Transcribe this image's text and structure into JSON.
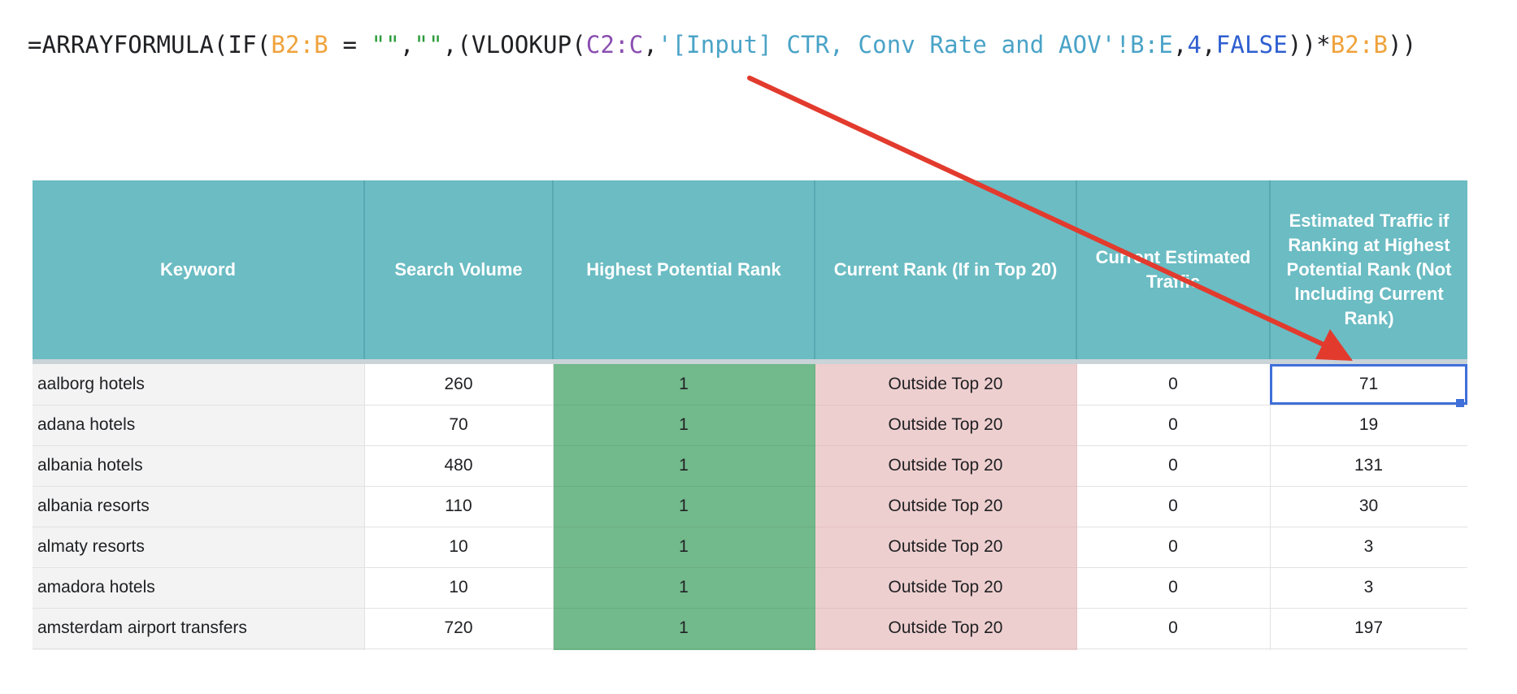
{
  "formula": {
    "tokens": [
      {
        "text": "=ARRAYFORMULA(IF(",
        "color": "#202124"
      },
      {
        "text": "B2:B",
        "color": "#f0a23b"
      },
      {
        "text": " = ",
        "color": "#202124"
      },
      {
        "text": "\"\"",
        "color": "#2b9c3a"
      },
      {
        "text": ",",
        "color": "#202124"
      },
      {
        "text": "\"\"",
        "color": "#2b9c3a"
      },
      {
        "text": ",(VLOOKUP(",
        "color": "#202124"
      },
      {
        "text": "C2:C",
        "color": "#8a4fb0"
      },
      {
        "text": ",",
        "color": "#202124"
      },
      {
        "text": "'[Input] CTR, Conv Rate and AOV'!B:E",
        "color": "#4aa3c7"
      },
      {
        "text": ",",
        "color": "#202124"
      },
      {
        "text": "4",
        "color": "#2f5fd0"
      },
      {
        "text": ",",
        "color": "#202124"
      },
      {
        "text": "FALSE",
        "color": "#2f5fd0"
      },
      {
        "text": "))*",
        "color": "#202124"
      },
      {
        "text": "B2:B",
        "color": "#f0a23b"
      },
      {
        "text": "))",
        "color": "#202124"
      }
    ]
  },
  "table": {
    "headers": [
      "Keyword",
      "Search Volume",
      "Highest Potential Rank",
      "Current Rank (If in Top 20)",
      "Current Estimated Traffic",
      "Estimated Traffic if Ranking at Highest Potential Rank (Not Including Current Rank)"
    ],
    "rows": [
      [
        "aalborg hotels",
        "260",
        "1",
        "Outside Top 20",
        "0",
        "71"
      ],
      [
        "adana hotels",
        "70",
        "1",
        "Outside Top 20",
        "0",
        "19"
      ],
      [
        "albania hotels",
        "480",
        "1",
        "Outside Top 20",
        "0",
        "131"
      ],
      [
        "albania resorts",
        "110",
        "1",
        "Outside Top 20",
        "0",
        "30"
      ],
      [
        "almaty resorts",
        "10",
        "1",
        "Outside Top 20",
        "0",
        "3"
      ],
      [
        "amadora hotels",
        "10",
        "1",
        "Outside Top 20",
        "0",
        "3"
      ],
      [
        "amsterdam airport transfers",
        "720",
        "1",
        "Outside Top 20",
        "0",
        "197"
      ],
      [
        "",
        "",
        "",
        "",
        "",
        ""
      ]
    ]
  },
  "colors": {
    "header_bg": "#6bbcc3",
    "potential_rank_bg": "#72b98b",
    "current_rank_bg": "#eecfcf",
    "selection": "#3f6fd8",
    "arrow": "#e23b2e"
  }
}
